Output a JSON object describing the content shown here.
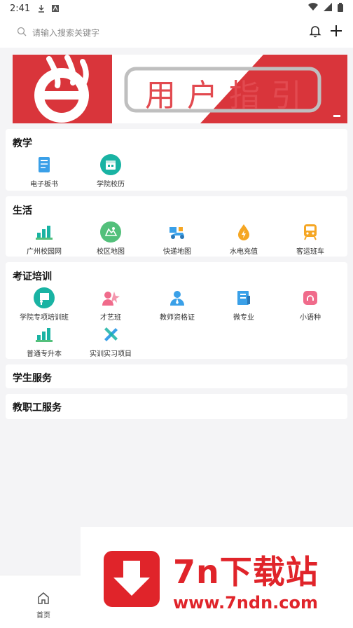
{
  "status_bar": {
    "time": "2:41"
  },
  "search": {
    "placeholder": "请输入搜索关键字"
  },
  "banner": {
    "text": "用户指引"
  },
  "sections": [
    {
      "title": "教学",
      "items": [
        {
          "label": "电子板书",
          "icon": "blackboard-icon"
        },
        {
          "label": "学院校历",
          "icon": "calendar-icon"
        }
      ]
    },
    {
      "title": "生活",
      "items": [
        {
          "label": "广州校园网",
          "icon": "campus-network-icon"
        },
        {
          "label": "校区地图",
          "icon": "map-icon"
        },
        {
          "label": "快递地图",
          "icon": "delivery-icon"
        },
        {
          "label": "水电充值",
          "icon": "utility-recharge-icon"
        },
        {
          "label": "客运班车",
          "icon": "bus-icon"
        }
      ]
    },
    {
      "title": "考证培训",
      "items": [
        {
          "label": "学院专项培训班",
          "icon": "training-icon"
        },
        {
          "label": "才艺班",
          "icon": "talent-icon"
        },
        {
          "label": "教师资格证",
          "icon": "teacher-cert-icon"
        },
        {
          "label": "微专业",
          "icon": "micro-major-icon"
        },
        {
          "label": "小语种",
          "icon": "language-icon"
        },
        {
          "label": "普通专升本",
          "icon": "upgrade-icon"
        },
        {
          "label": "实训实习项目",
          "icon": "internship-icon"
        }
      ]
    },
    {
      "title": "学生服务",
      "items": []
    },
    {
      "title": "教职工服务",
      "items": []
    }
  ],
  "bottom_nav": {
    "home_label": "首页"
  },
  "watermark": {
    "title": "7n下载站",
    "url": "www.7ndn.com"
  },
  "colors": {
    "accent_red": "#e0242a",
    "teal": "#19b3a3",
    "blue": "#3aa0e8",
    "orange": "#f5a623",
    "green": "#53c07b",
    "pink": "#f06b8b"
  }
}
